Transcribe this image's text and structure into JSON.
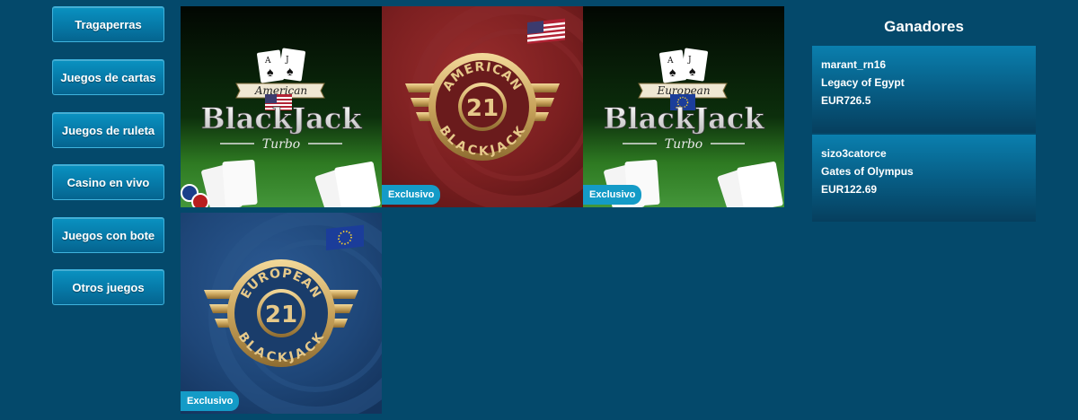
{
  "categories": [
    {
      "label": "Tragaperras"
    },
    {
      "label": "Juegos de cartas"
    },
    {
      "label": "Juegos de ruleta"
    },
    {
      "label": "Casino en vivo"
    },
    {
      "label": "Juegos con bote"
    },
    {
      "label": "Otros juegos"
    }
  ],
  "games": [
    {
      "logo_word1": "American",
      "logo_word2": "BlackJack",
      "logo_word3": "Turbo",
      "flag": "usa-flag-icon"
    },
    {
      "arc_top": "AMERICAN",
      "arc_bottom": "BLACKJACK",
      "number": "21",
      "badge": "Exclusivo",
      "flag": "usa-flag-icon"
    },
    {
      "logo_word1": "European",
      "logo_word2": "BlackJack",
      "logo_word3": "Turbo",
      "badge": "Exclusivo",
      "flag": "eu-flag-icon"
    },
    {
      "arc_top": "EUROPEAN",
      "arc_bottom": "BLACKJACK",
      "number": "21",
      "badge": "Exclusivo",
      "flag": "eu-flag-icon"
    }
  ],
  "winners": {
    "title": "Ganadores",
    "items": [
      {
        "user": "marant_rn16",
        "game": "Legacy of Egypt",
        "amount": "EUR726.5"
      },
      {
        "user": "sizo3catorce",
        "game": "Gates of Olympus",
        "amount": "EUR122.69"
      }
    ]
  },
  "colors": {
    "page_bg": "#04496b",
    "button_bg": "#0679a7",
    "badge_bg": "#149bc7",
    "winner_bg": "#075e86"
  }
}
